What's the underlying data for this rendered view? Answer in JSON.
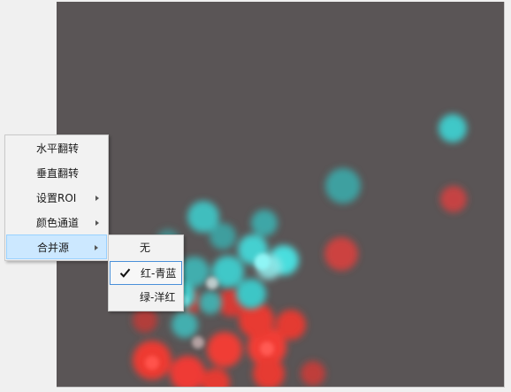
{
  "context_menu": {
    "items": [
      {
        "label": "水平翻转",
        "has_submenu": false
      },
      {
        "label": "垂直翻转",
        "has_submenu": false
      },
      {
        "label": "设置ROI",
        "has_submenu": true
      },
      {
        "label": "颜色通道",
        "has_submenu": true
      },
      {
        "label": "合并源",
        "has_submenu": true,
        "highlighted": true
      }
    ]
  },
  "submenu": {
    "items": [
      {
        "label": "无",
        "checked": false
      },
      {
        "label": "红-青蓝",
        "checked": true
      },
      {
        "label": "绿-洋红",
        "checked": false
      }
    ]
  },
  "colors": {
    "image_background": "#5a5556",
    "cyan_channel": "#3fd6d6",
    "red_channel": "#f03a32",
    "menu_highlight": "#cce8ff",
    "check_border": "#4a90d9"
  }
}
